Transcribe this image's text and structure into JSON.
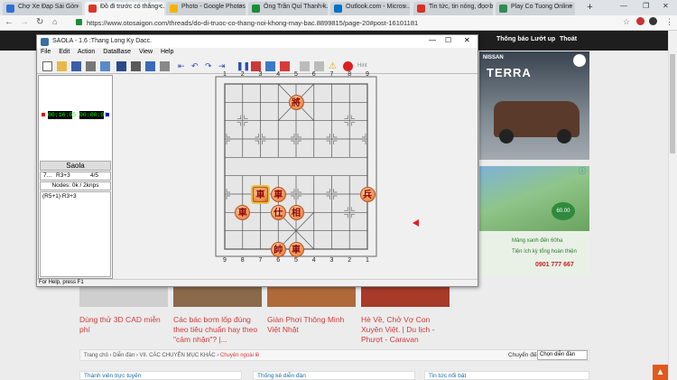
{
  "browser": {
    "tabs": [
      {
        "title": "Chợ Xe Đạp Sài Gòn",
        "icon": "bike-favicon",
        "color": "#2f6fd6"
      },
      {
        "title": "Đồ đi trước có thắng c...",
        "icon": "otosaigon-favicon",
        "color": "#d83a2a"
      },
      {
        "title": "Photo - Google Photos",
        "icon": "photos-favicon",
        "color": "#f2b400"
      },
      {
        "title": "Ông Trần Quí Thanh k...",
        "icon": "news-favicon",
        "color": "#1a8c3a"
      },
      {
        "title": "Outlook.com - Micros...",
        "icon": "outlook-favicon",
        "color": "#0072c6"
      },
      {
        "title": "Tin tức, tin nóng, đọc b...",
        "icon": "gmail-favicon",
        "color": "#d93025"
      },
      {
        "title": "Play Co Tuong Online",
        "icon": "game-favicon",
        "color": "#2e8b57"
      }
    ],
    "url": "https://www.otosaigon.com/threads/do-di-truoc-co-thang-noi-khong-may-bac.8899815/page-20#post-16101181"
  },
  "site": {
    "nav": [
      "Thông báo",
      "Lướt up",
      "Thoát"
    ],
    "ad_top": {
      "brand": "NISSAN",
      "title": "TERRA"
    },
    "ad_bottom": {
      "lines": [
        "Mảng xanh đến 60ha",
        "Tiện ích kỳ tổng hoàn thiện"
      ],
      "phone": "0901 777 667",
      "badge": "60.00"
    },
    "cards": [
      "Dùng thử 3D CAD miễn phí",
      "Các bác bơm lốp đúng theo tiêu chuẩn hay theo \"cảm nhận\"? |...",
      "Giàn Phơi Thông Minh Việt Nhật",
      "Hè Về, Chở Vợ Con Xuyên Việt. | Du lịch - Phượt - Caravan"
    ],
    "breadcrumb": [
      "Trang chủ",
      "Diễn đàn",
      "VII. CÁC CHUYÊN MỤC KHÁC",
      "Chuyện ngoài lề"
    ],
    "jump_label": "Chuyển đến",
    "jump_value": "Chọn diễn đàn",
    "box_heads": [
      "Thành viên trực tuyến",
      "Thống kê diễn đàn",
      "Tin tức nổi bật"
    ]
  },
  "saola": {
    "title": "SAOLA - 1.6 :Thang Long Ky Dacc.",
    "menu": [
      "File",
      "Edit",
      "Action",
      "DataBase",
      "View",
      "Help"
    ],
    "toolbar_text": "Hint",
    "clock_red": "00:16:05",
    "clock_black": "00:00:00",
    "engine_name": "Saola",
    "move_no": "7...",
    "move": "R3+3",
    "score": "4/5",
    "nodes": "Nodes: 0k / 2knps",
    "pv": "(R5+1) R3+3",
    "status": "For Help, press F1",
    "top_coords": [
      "1",
      "2",
      "3",
      "4",
      "5",
      "6",
      "7",
      "8",
      "9"
    ],
    "bottom_coords": [
      "9",
      "8",
      "7",
      "6",
      "5",
      "4",
      "3",
      "2",
      "1"
    ],
    "pieces": [
      {
        "char": "將",
        "file": 5,
        "rank": 2
      },
      {
        "char": "車",
        "file": 3,
        "rank": 7,
        "selected": true
      },
      {
        "char": "車",
        "file": 4,
        "rank": 7
      },
      {
        "char": "兵",
        "file": 9,
        "rank": 7
      },
      {
        "char": "車",
        "file": 2,
        "rank": 8
      },
      {
        "char": "仕",
        "file": 4,
        "rank": 8
      },
      {
        "char": "相",
        "file": 5,
        "rank": 8
      },
      {
        "char": "帥",
        "file": 4,
        "rank": 10
      },
      {
        "char": "車",
        "file": 5,
        "rank": 10
      }
    ]
  }
}
